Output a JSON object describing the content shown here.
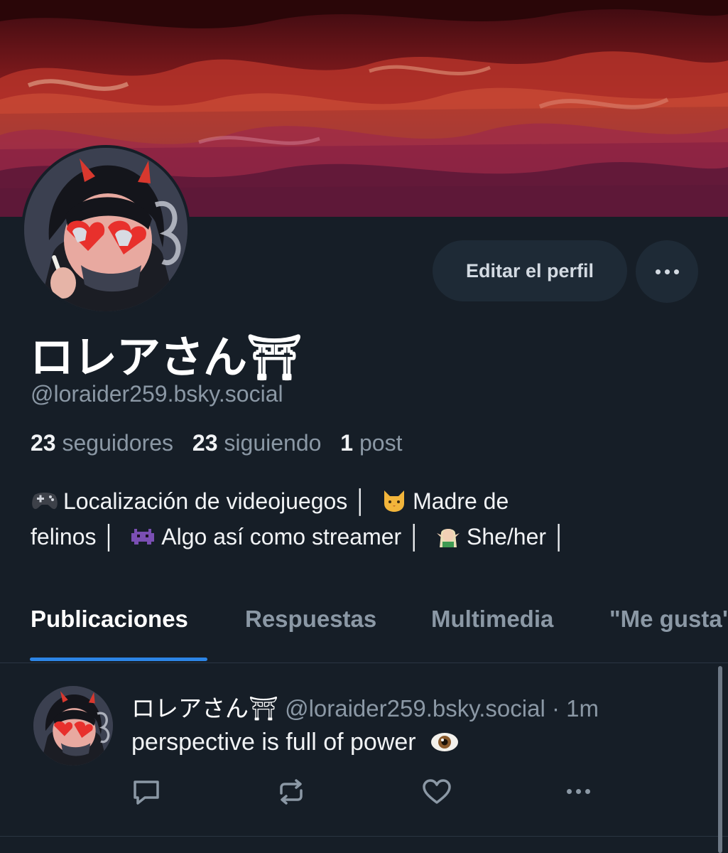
{
  "profile": {
    "display_name": "ロレアさん⛩",
    "handle": "@loraider259.bsky.social",
    "followers_count": "23",
    "followers_label": "seguidores",
    "following_count": "23",
    "following_label": "siguiendo",
    "posts_count": "1",
    "posts_label": "post",
    "bio_line1_a": "Localización de videojuegos │",
    "bio_line1_b": "Madre de",
    "bio_line2_a": "felinos │",
    "bio_line2_b": "Algo así como streamer │",
    "bio_line2_c": "She/her │"
  },
  "actions": {
    "edit_label": "Editar el perfil",
    "more_icon": "ellipsis-icon"
  },
  "tabs": [
    {
      "label": "Publicaciones",
      "active": true
    },
    {
      "label": "Respuestas"
    },
    {
      "label": "Multimedia"
    },
    {
      "label": "\"Me gusta\""
    }
  ],
  "post": {
    "author_name": "ロレアさん⛩",
    "author_handle": "@loraider259.bsky.social",
    "separator": "·",
    "time": "1m",
    "text": "perspective is full of power"
  },
  "colors": {
    "background": "#161e27",
    "accent": "#2c85e6",
    "muted_text": "#8b98a5",
    "button_bg": "#1e2a36"
  }
}
